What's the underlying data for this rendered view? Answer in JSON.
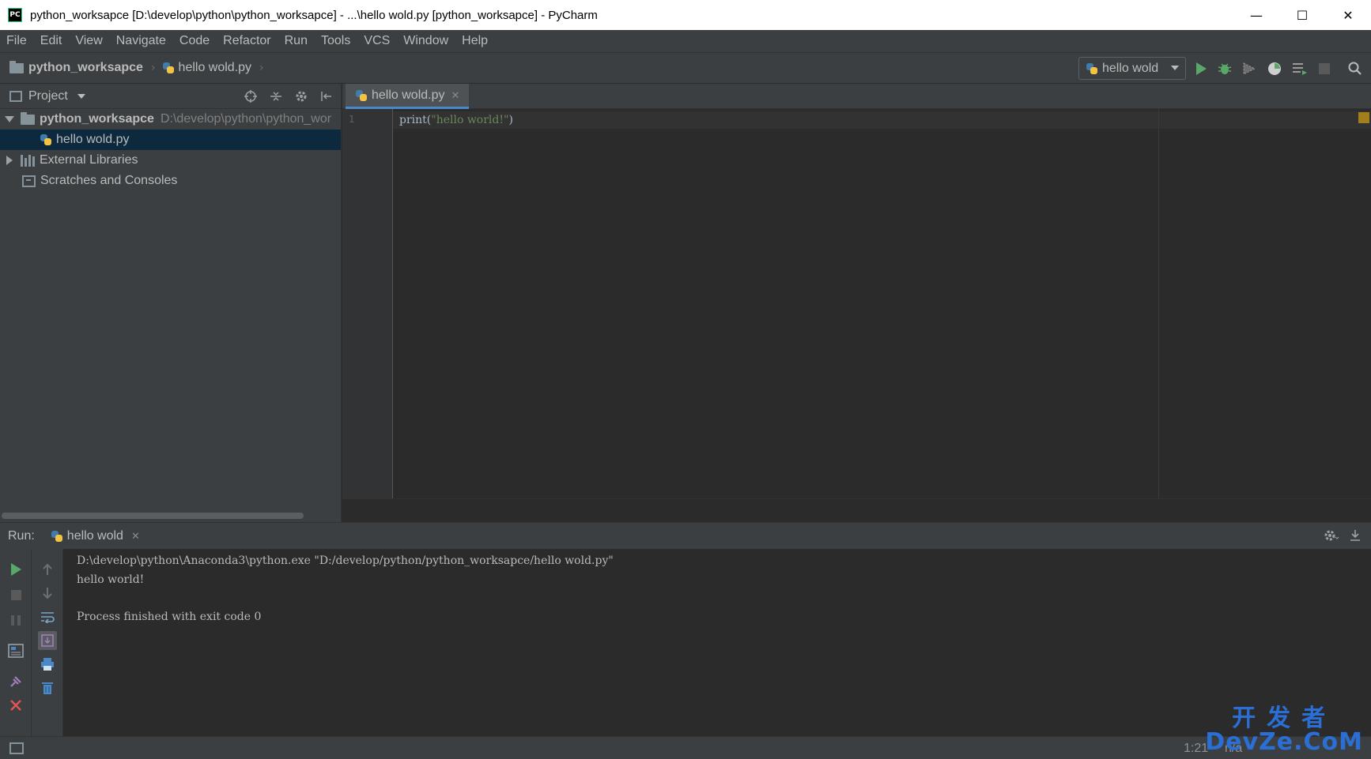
{
  "window": {
    "title": "python_worksapce [D:\\develop\\python\\python_worksapce] - ...\\hello wold.py [python_worksapce] - PyCharm",
    "app_icon_text": "PC",
    "minimize_glyph": "—",
    "maximize_glyph": "☐",
    "close_glyph": "✕"
  },
  "menu": [
    "File",
    "Edit",
    "View",
    "Navigate",
    "Code",
    "Refactor",
    "Run",
    "Tools",
    "VCS",
    "Window",
    "Help"
  ],
  "navbar": {
    "project": "python_worksapce",
    "file": "hello wold.py",
    "separator": "›",
    "run_config": "hello wold"
  },
  "project_panel": {
    "title": "Project",
    "tree": [
      {
        "label": "python_worksapce",
        "path": "D:\\develop\\python\\python_wor"
      },
      {
        "label": "hello wold.py"
      },
      {
        "label": "External Libraries"
      },
      {
        "label": "Scratches and Consoles"
      }
    ]
  },
  "editor": {
    "tab_label": "hello wold.py",
    "close_glyph": "✕",
    "line_number": "1",
    "code": {
      "fn": "print(",
      "str": "\"hello world!\"",
      "end": ")"
    }
  },
  "run_panel": {
    "label": "Run:",
    "tab_label": "hello wold",
    "close_glyph": "✕",
    "console": [
      "D:\\develop\\python\\Anaconda3\\python.exe \"D:/develop/python/python_worksapce/hello wold.py\"",
      "hello world!",
      "",
      "Process finished with exit code 0"
    ]
  },
  "statusbar": {
    "position": "1:21",
    "na": "n/a"
  },
  "watermark": {
    "cn": "开发者",
    "en": "DevZe.CoM"
  },
  "colors": {
    "accent": "#4a88c7",
    "run_green": "#59a869",
    "stop_red": "#e05555",
    "selection": "#0d293e"
  },
  "icons": [
    "run-icon",
    "debug-icon",
    "coverage-icon",
    "profile-icon",
    "concurrency-icon",
    "stop-icon",
    "search-icon",
    "locate-icon",
    "collapse-icon",
    "gear-icon",
    "hide-icon"
  ]
}
